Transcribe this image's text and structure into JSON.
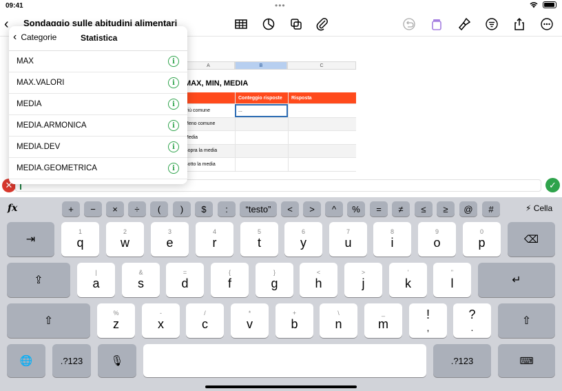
{
  "status": {
    "time": "09:41",
    "dots": "•••"
  },
  "toolbar": {
    "title": "Sondaggio sulle abitudini alimentari"
  },
  "sheet": {
    "columns": [
      "A",
      "B",
      "C"
    ],
    "table_title": "MAX, MIN, MEDIA",
    "headers": [
      "",
      "Conteggio risposte",
      "Risposta"
    ],
    "rows": [
      [
        "Più comune",
        "...",
        ""
      ],
      [
        "Meno comune",
        "",
        ""
      ],
      [
        "Media",
        "",
        ""
      ],
      [
        "Sopra la media",
        "",
        ""
      ],
      [
        "Sotto la media",
        "",
        ""
      ]
    ]
  },
  "popover": {
    "back_label": "Categorie",
    "title": "Statistica",
    "items": [
      "MAX",
      "MAX.VALORI",
      "MEDIA",
      "MEDIA.ARMONICA",
      "MEDIA.DEV",
      "MEDIA.GEOMETRICA"
    ]
  },
  "keyboard": {
    "func_keys": [
      "+",
      "−",
      "×",
      "÷",
      "(",
      ")",
      "$",
      ":",
      "“testo”",
      "<",
      ">",
      "^",
      "%",
      "=",
      "≠",
      "≤",
      "≥",
      "@",
      "#"
    ],
    "cella_label": "Cella",
    "row1": [
      [
        "1",
        "q"
      ],
      [
        "2",
        "w"
      ],
      [
        "3",
        "e"
      ],
      [
        "4",
        "r"
      ],
      [
        "5",
        "t"
      ],
      [
        "6",
        "y"
      ],
      [
        "7",
        "u"
      ],
      [
        "8",
        "i"
      ],
      [
        "9",
        "o"
      ],
      [
        "0",
        "p"
      ]
    ],
    "row2": [
      [
        "|",
        "a"
      ],
      [
        "&",
        "s"
      ],
      [
        "=",
        "d"
      ],
      [
        "{",
        "f"
      ],
      [
        "}",
        "g"
      ],
      [
        "<",
        "h"
      ],
      [
        ">",
        "j"
      ],
      [
        "'",
        "k"
      ],
      [
        "\"",
        "l"
      ]
    ],
    "row3": [
      [
        "%",
        "z"
      ],
      [
        "-",
        "x"
      ],
      [
        "/",
        "c"
      ],
      [
        "*",
        "v"
      ],
      [
        "+",
        "b"
      ],
      [
        "\\",
        "n"
      ],
      [
        "_",
        "m"
      ],
      [
        "",
        "!"
      ],
      [
        "",
        "?"
      ]
    ],
    "row3_sub2": [
      ",",
      "."
    ],
    "num_label": ".?123"
  },
  "colors": {
    "accent_green": "#2ea34b",
    "header_orange": "#ff4a1c",
    "cancel_red": "#d9382d"
  }
}
